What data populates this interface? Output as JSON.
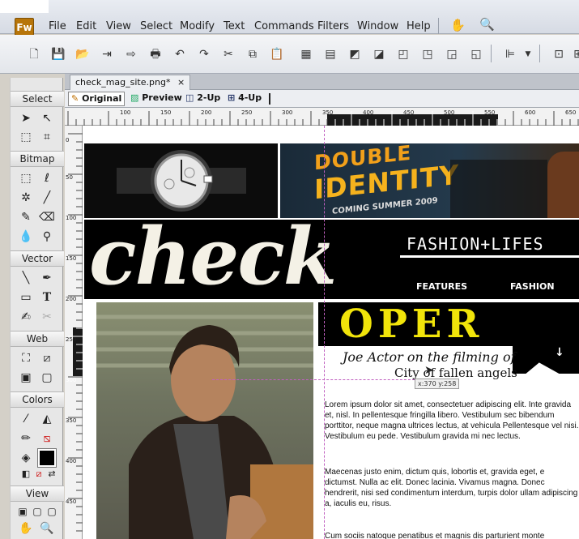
{
  "app": {
    "logo": "Fw"
  },
  "menu": [
    "File",
    "Edit",
    "View",
    "Select",
    "Modify",
    "Text",
    "Commands",
    "Filters",
    "Window",
    "Help"
  ],
  "doc": {
    "tab": "check_mag_site.png*",
    "close": "×"
  },
  "view": {
    "original": "Original",
    "preview": "Preview",
    "two_up": "2-Up",
    "four_up": "4-Up"
  },
  "tools": {
    "select": "Select",
    "bitmap": "Bitmap",
    "vector": "Vector",
    "web": "Web",
    "colors": "Colors",
    "view": "View"
  },
  "ruler_h": [
    "100",
    "150",
    "200",
    "250",
    "300",
    "350",
    "400",
    "450",
    "500",
    "550",
    "600",
    "650"
  ],
  "ruler_v": [
    "0",
    "50",
    "100",
    "150",
    "200",
    "250",
    "300",
    "350",
    "400",
    "450"
  ],
  "site": {
    "banner_line1": "DOUBLE",
    "banner_line2": "IDENTITY",
    "banner_sub": "COMING SUMMER 2009",
    "logo": "check",
    "tagline": "FASHION+LIFES",
    "nav_features": "FEATURES",
    "nav_fashion": "FASHION",
    "headline": "OPER",
    "caption1": "Joe Actor on the filming of",
    "caption2": "City of fallen angels",
    "coords": "x:370 y:258",
    "para1": "Lorem ipsum dolor sit amet, consectetuer adipiscing elit. Inte gravida et, nisl. In pellentesque fringilla libero. Vestibulum sec bibendum porttitor, neque magna ultrices lectus, at vehicula Pellentesque vel nisi. Vestibulum eu pede. Vestibulum gravida mi nec lectus.",
    "para2": "Maecenas justo enim, dictum quis, lobortis et, gravida eget, e dictumst. Nulla ac elit. Donec lacinia. Vivamus magna. Donec hendrerit, nisi sed condimentum interdum, turpis dolor ullam adipiscing a, iaculis eu, risus.",
    "para3": "Cum sociis natoque penatibus et magnis dis parturient monte"
  }
}
